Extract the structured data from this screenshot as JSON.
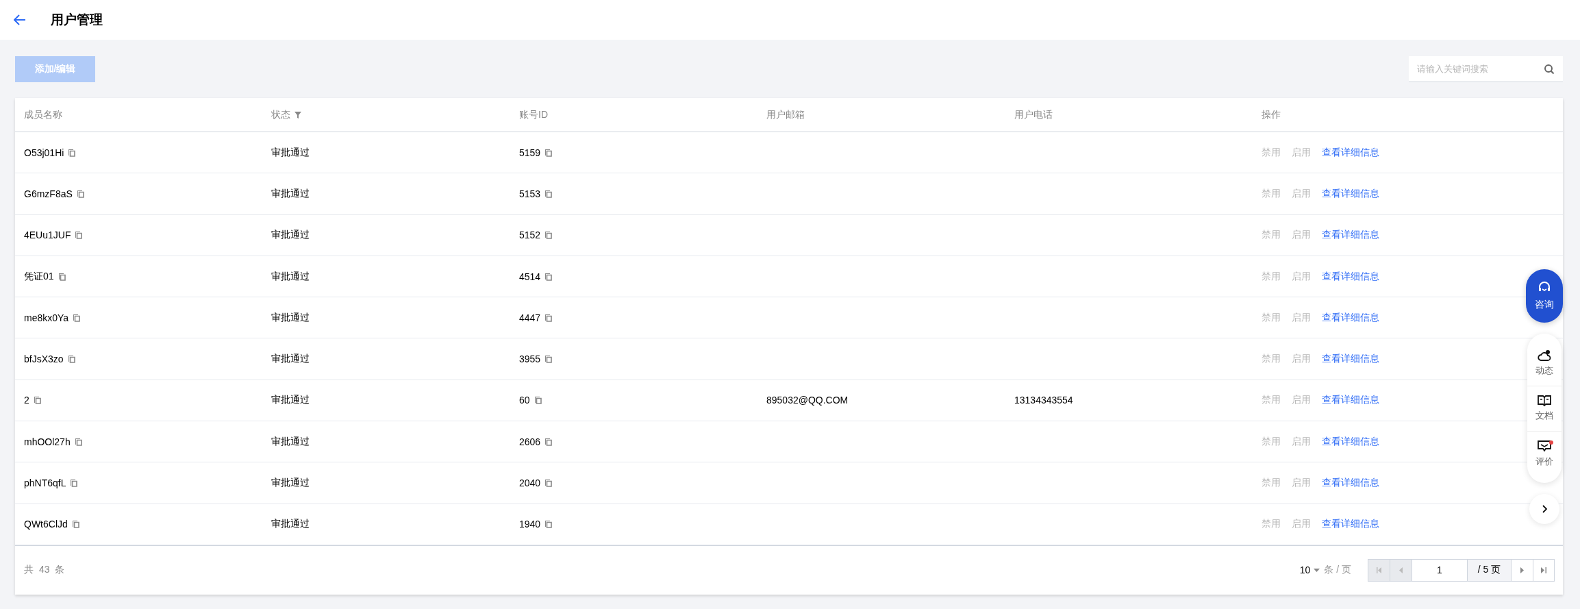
{
  "header": {
    "title": "用户管理"
  },
  "toolbar": {
    "add_button": {
      "label": "添加/编辑",
      "disabled": true
    },
    "search": {
      "placeholder": "请输入关键词搜索"
    }
  },
  "table": {
    "columns": [
      {
        "label": "成员名称",
        "filter": false
      },
      {
        "label": "状态",
        "filter": true
      },
      {
        "label": "账号ID",
        "filter": false
      },
      {
        "label": "用户邮箱",
        "filter": false
      },
      {
        "label": "用户电话",
        "filter": false
      },
      {
        "label": "操作",
        "filter": false
      }
    ],
    "rows": [
      {
        "name": "O53j01Hi",
        "status": "审批通过",
        "account_id": "5159",
        "actions": [
          {
            "label": "禁用",
            "disabled": true
          },
          {
            "label": "启用",
            "disabled": true
          },
          {
            "label": "查看详细信息",
            "disabled": false
          }
        ]
      },
      {
        "name": "G6mzF8aS",
        "status": "审批通过",
        "account_id": "5153",
        "actions": [
          {
            "label": "禁用",
            "disabled": true
          },
          {
            "label": "启用",
            "disabled": true
          },
          {
            "label": "查看详细信息",
            "disabled": false
          }
        ]
      },
      {
        "name": "4EUu1JUF",
        "status": "审批通过",
        "account_id": "5152",
        "actions": [
          {
            "label": "禁用",
            "disabled": true
          },
          {
            "label": "启用",
            "disabled": true
          },
          {
            "label": "查看详细信息",
            "disabled": false
          }
        ]
      },
      {
        "name": "凭证01",
        "status": "审批通过",
        "account_id": "4514",
        "actions": [
          {
            "label": "禁用",
            "disabled": true
          },
          {
            "label": "启用",
            "disabled": true
          },
          {
            "label": "查看详细信息",
            "disabled": false
          }
        ]
      },
      {
        "name": "me8kx0Ya",
        "status": "审批通过",
        "account_id": "4447",
        "actions": [
          {
            "label": "禁用",
            "disabled": true
          },
          {
            "label": "启用",
            "disabled": true
          },
          {
            "label": "查看详细信息",
            "disabled": false
          }
        ]
      },
      {
        "name": "bfJsX3zo",
        "status": "审批通过",
        "account_id": "3955",
        "actions": [
          {
            "label": "禁用",
            "disabled": true
          },
          {
            "label": "启用",
            "disabled": true
          },
          {
            "label": "查看详细信息",
            "disabled": false
          }
        ]
      },
      {
        "name": "2",
        "status": "审批通过",
        "account_id": "60",
        "email": "895032@QQ.COM",
        "phone": "13134343554",
        "actions": [
          {
            "label": "禁用",
            "disabled": true
          },
          {
            "label": "启用",
            "disabled": true
          },
          {
            "label": "查看详细信息",
            "disabled": false
          }
        ]
      },
      {
        "name": "mhOOl27h",
        "status": "审批通过",
        "account_id": "2606",
        "actions": [
          {
            "label": "禁用",
            "disabled": true
          },
          {
            "label": "启用",
            "disabled": true
          },
          {
            "label": "查看详细信息",
            "disabled": false
          }
        ]
      },
      {
        "name": "phNT6qfL",
        "status": "审批通过",
        "account_id": "2040",
        "actions": [
          {
            "label": "禁用",
            "disabled": true
          },
          {
            "label": "启用",
            "disabled": true
          },
          {
            "label": "查看详细信息",
            "disabled": false
          }
        ]
      },
      {
        "name": "QWt6ClJd",
        "status": "审批通过",
        "account_id": "1940",
        "actions": [
          {
            "label": "禁用",
            "disabled": true
          },
          {
            "label": "启用",
            "disabled": true
          },
          {
            "label": "查看详细信息",
            "disabled": false
          }
        ]
      }
    ]
  },
  "footer": {
    "total": "共 43 条",
    "page_size": "10",
    "page_size_unit": "条 / 页",
    "page": "1",
    "page_total": "/ 5 页",
    "nav": [
      {
        "kind": "first",
        "disabled": true
      },
      {
        "kind": "prev",
        "disabled": true
      },
      {
        "kind": "next",
        "disabled": false
      },
      {
        "kind": "last",
        "disabled": false
      }
    ]
  },
  "side_widget": {
    "consult": {
      "label": "咨询"
    },
    "items": [
      {
        "kind": "news",
        "label": "动态",
        "badge": false
      },
      {
        "kind": "docs",
        "label": "文档",
        "badge": false
      },
      {
        "kind": "review",
        "label": "评价",
        "badge": true
      }
    ]
  }
}
